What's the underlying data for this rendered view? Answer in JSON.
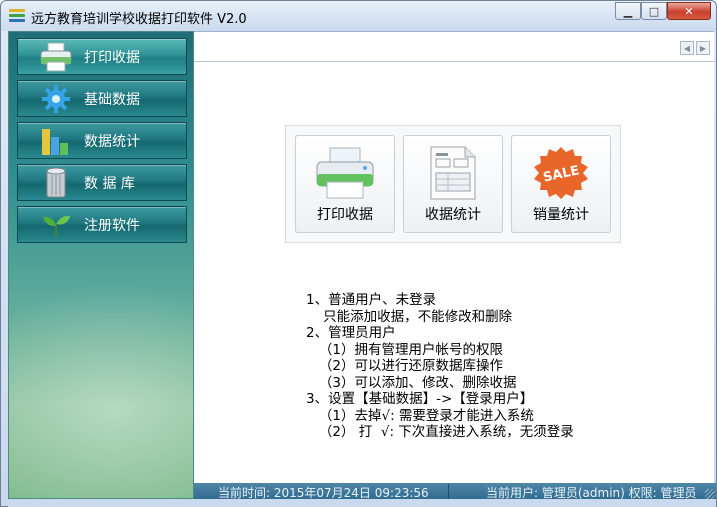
{
  "window": {
    "title": "远方教育培训学校收据打印软件 V2.0",
    "minimize_glyph": "▁",
    "maximize_glyph": "□",
    "close_glyph": "✕"
  },
  "sidebar": {
    "items": [
      {
        "label": "打印收据",
        "icon": "printer-icon"
      },
      {
        "label": "基础数据",
        "icon": "gear-icon"
      },
      {
        "label": "数据统计",
        "icon": "bar-chart-icon"
      },
      {
        "label": "数 据 库",
        "icon": "database-icon"
      },
      {
        "label": "注册软件",
        "icon": "sprout-icon"
      }
    ]
  },
  "main": {
    "scroll_left": "◀",
    "scroll_right": "▶",
    "tiles": [
      {
        "label": "打印收据",
        "icon": "printer-icon"
      },
      {
        "label": "收据统计",
        "icon": "document-icon"
      },
      {
        "label": "销量统计",
        "icon": "sale-badge-icon",
        "badge_text": "SALE"
      }
    ],
    "help_lines": [
      "1、普通用户、未登录",
      "    只能添加收据，不能修改和删除",
      "",
      "2、管理员用户",
      "   （1）拥有管理用户帐号的权限",
      "   （2）可以进行还原数据库操作",
      "   （3）可以添加、修改、删除收据",
      "",
      "3、设置【基础数据】->【登录用户】",
      "   （1）去掉√: 需要登录才能进入系统",
      "   （2） 打  √: 下次直接进入系统，无须登录"
    ]
  },
  "statusbar": {
    "time": "当前时间: 2015年07月24日 09:23:56",
    "user": "当前用户: 管理员(admin)  权限: 管理员"
  },
  "colors": {
    "sidebar_top": "#1f6e78",
    "sidebar_bottom": "#8fc49e",
    "statusbar": "#2f6a8e",
    "close_button": "#c8412d"
  }
}
